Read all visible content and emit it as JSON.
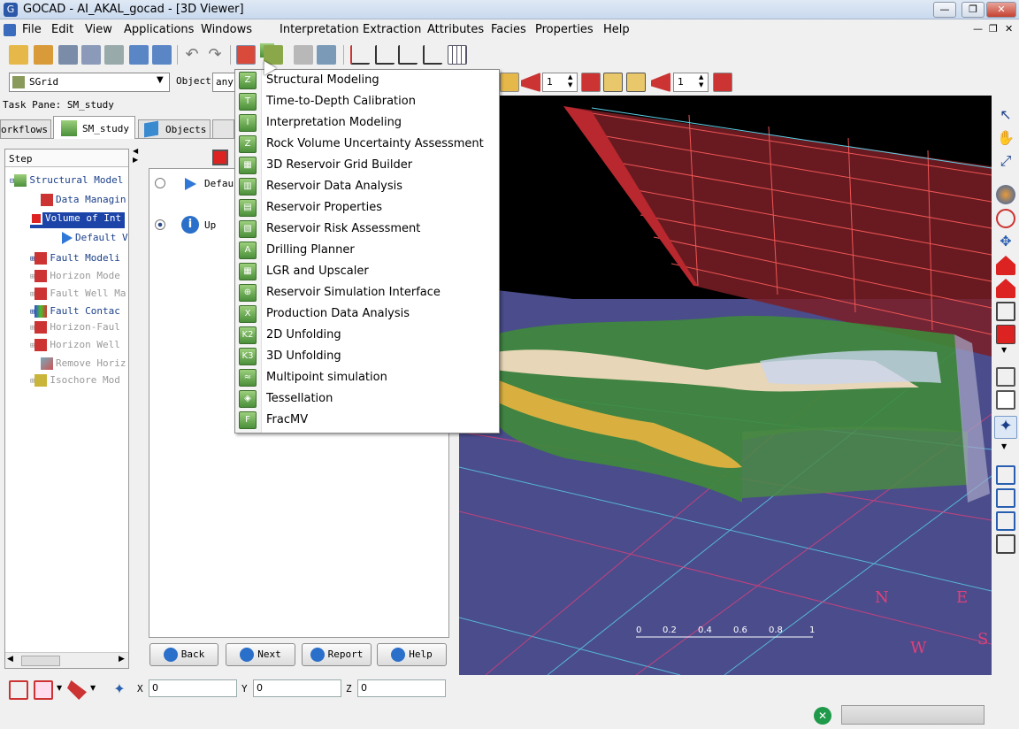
{
  "window": {
    "title": "GOCAD - AI_AKAL_gocad  - [3D Viewer]"
  },
  "menubar": {
    "items": [
      "File",
      "Edit",
      "View",
      "Applications",
      "Windows",
      "Interpretation",
      "Extraction",
      "Attributes",
      "Facies",
      "Properties",
      "Help"
    ]
  },
  "toolbar2": {
    "object_type": "SGrid",
    "object_label": "Object",
    "object_value": "any",
    "spin1": "1",
    "spin2": "1"
  },
  "left": {
    "task_pane": "Task Pane: SM_study",
    "tabs": [
      "orkflows",
      "SM_study",
      "Objects"
    ],
    "step_header": "Step",
    "tree": [
      "Structural Model",
      "Data Managin",
      "Volume of Int",
      "Default V",
      "Fault Modeli",
      "Horizon Mode",
      "Fault Well Ma",
      "Fault Contac",
      "Horizon-Faul",
      "Horizon Well",
      "Remove Horiz",
      "Isochore Mod"
    ]
  },
  "center": {
    "option1": "Defaul",
    "option2": "Up"
  },
  "buttons": {
    "back": "Back",
    "next": "Next",
    "report": "Report",
    "help": "Help"
  },
  "menu": {
    "items": [
      "Structural Modeling",
      "Time-to-Depth Calibration",
      "Interpretation Modeling",
      "Rock Volume Uncertainty Assessment",
      "3D Reservoir Grid Builder",
      "Reservoir Data Analysis",
      "Reservoir Properties",
      "Reservoir Risk Assessment",
      "Drilling Planner",
      "LGR and Upscaler",
      "Reservoir Simulation Interface",
      "Production Data Analysis",
      "2D Unfolding",
      "3D Unfolding",
      "Multipoint simulation",
      "Tessellation",
      "FracMV"
    ]
  },
  "viewer": {
    "scale_ticks": [
      "0",
      "0.2",
      "0.4",
      "0.6",
      "0.8",
      "1"
    ],
    "compass": {
      "n": "N",
      "e": "E",
      "w": "W",
      "s": "S"
    }
  },
  "coords": {
    "x_label": "X",
    "x": "0",
    "y_label": "Y",
    "y": "0",
    "z_label": "Z",
    "z": "0"
  }
}
